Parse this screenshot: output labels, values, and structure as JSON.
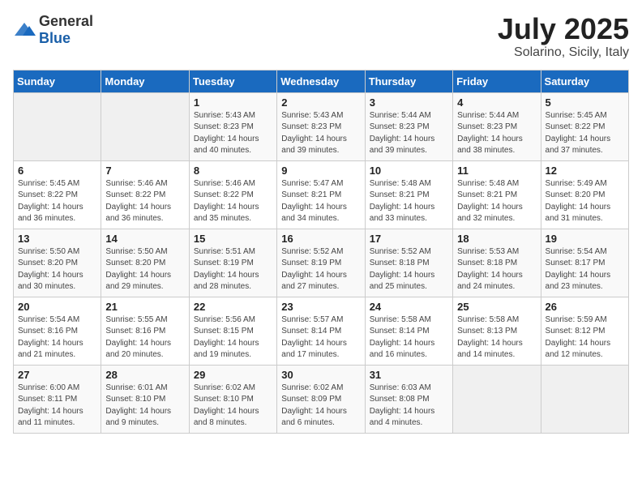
{
  "logo": {
    "general": "General",
    "blue": "Blue"
  },
  "header": {
    "month": "July 2025",
    "location": "Solarino, Sicily, Italy"
  },
  "days_of_week": [
    "Sunday",
    "Monday",
    "Tuesday",
    "Wednesday",
    "Thursday",
    "Friday",
    "Saturday"
  ],
  "weeks": [
    [
      {
        "day": "",
        "sunrise": "",
        "sunset": "",
        "daylight": ""
      },
      {
        "day": "",
        "sunrise": "",
        "sunset": "",
        "daylight": ""
      },
      {
        "day": "1",
        "sunrise": "Sunrise: 5:43 AM",
        "sunset": "Sunset: 8:23 PM",
        "daylight": "Daylight: 14 hours and 40 minutes."
      },
      {
        "day": "2",
        "sunrise": "Sunrise: 5:43 AM",
        "sunset": "Sunset: 8:23 PM",
        "daylight": "Daylight: 14 hours and 39 minutes."
      },
      {
        "day": "3",
        "sunrise": "Sunrise: 5:44 AM",
        "sunset": "Sunset: 8:23 PM",
        "daylight": "Daylight: 14 hours and 39 minutes."
      },
      {
        "day": "4",
        "sunrise": "Sunrise: 5:44 AM",
        "sunset": "Sunset: 8:23 PM",
        "daylight": "Daylight: 14 hours and 38 minutes."
      },
      {
        "day": "5",
        "sunrise": "Sunrise: 5:45 AM",
        "sunset": "Sunset: 8:22 PM",
        "daylight": "Daylight: 14 hours and 37 minutes."
      }
    ],
    [
      {
        "day": "6",
        "sunrise": "Sunrise: 5:45 AM",
        "sunset": "Sunset: 8:22 PM",
        "daylight": "Daylight: 14 hours and 36 minutes."
      },
      {
        "day": "7",
        "sunrise": "Sunrise: 5:46 AM",
        "sunset": "Sunset: 8:22 PM",
        "daylight": "Daylight: 14 hours and 36 minutes."
      },
      {
        "day": "8",
        "sunrise": "Sunrise: 5:46 AM",
        "sunset": "Sunset: 8:22 PM",
        "daylight": "Daylight: 14 hours and 35 minutes."
      },
      {
        "day": "9",
        "sunrise": "Sunrise: 5:47 AM",
        "sunset": "Sunset: 8:21 PM",
        "daylight": "Daylight: 14 hours and 34 minutes."
      },
      {
        "day": "10",
        "sunrise": "Sunrise: 5:48 AM",
        "sunset": "Sunset: 8:21 PM",
        "daylight": "Daylight: 14 hours and 33 minutes."
      },
      {
        "day": "11",
        "sunrise": "Sunrise: 5:48 AM",
        "sunset": "Sunset: 8:21 PM",
        "daylight": "Daylight: 14 hours and 32 minutes."
      },
      {
        "day": "12",
        "sunrise": "Sunrise: 5:49 AM",
        "sunset": "Sunset: 8:20 PM",
        "daylight": "Daylight: 14 hours and 31 minutes."
      }
    ],
    [
      {
        "day": "13",
        "sunrise": "Sunrise: 5:50 AM",
        "sunset": "Sunset: 8:20 PM",
        "daylight": "Daylight: 14 hours and 30 minutes."
      },
      {
        "day": "14",
        "sunrise": "Sunrise: 5:50 AM",
        "sunset": "Sunset: 8:20 PM",
        "daylight": "Daylight: 14 hours and 29 minutes."
      },
      {
        "day": "15",
        "sunrise": "Sunrise: 5:51 AM",
        "sunset": "Sunset: 8:19 PM",
        "daylight": "Daylight: 14 hours and 28 minutes."
      },
      {
        "day": "16",
        "sunrise": "Sunrise: 5:52 AM",
        "sunset": "Sunset: 8:19 PM",
        "daylight": "Daylight: 14 hours and 27 minutes."
      },
      {
        "day": "17",
        "sunrise": "Sunrise: 5:52 AM",
        "sunset": "Sunset: 8:18 PM",
        "daylight": "Daylight: 14 hours and 25 minutes."
      },
      {
        "day": "18",
        "sunrise": "Sunrise: 5:53 AM",
        "sunset": "Sunset: 8:18 PM",
        "daylight": "Daylight: 14 hours and 24 minutes."
      },
      {
        "day": "19",
        "sunrise": "Sunrise: 5:54 AM",
        "sunset": "Sunset: 8:17 PM",
        "daylight": "Daylight: 14 hours and 23 minutes."
      }
    ],
    [
      {
        "day": "20",
        "sunrise": "Sunrise: 5:54 AM",
        "sunset": "Sunset: 8:16 PM",
        "daylight": "Daylight: 14 hours and 21 minutes."
      },
      {
        "day": "21",
        "sunrise": "Sunrise: 5:55 AM",
        "sunset": "Sunset: 8:16 PM",
        "daylight": "Daylight: 14 hours and 20 minutes."
      },
      {
        "day": "22",
        "sunrise": "Sunrise: 5:56 AM",
        "sunset": "Sunset: 8:15 PM",
        "daylight": "Daylight: 14 hours and 19 minutes."
      },
      {
        "day": "23",
        "sunrise": "Sunrise: 5:57 AM",
        "sunset": "Sunset: 8:14 PM",
        "daylight": "Daylight: 14 hours and 17 minutes."
      },
      {
        "day": "24",
        "sunrise": "Sunrise: 5:58 AM",
        "sunset": "Sunset: 8:14 PM",
        "daylight": "Daylight: 14 hours and 16 minutes."
      },
      {
        "day": "25",
        "sunrise": "Sunrise: 5:58 AM",
        "sunset": "Sunset: 8:13 PM",
        "daylight": "Daylight: 14 hours and 14 minutes."
      },
      {
        "day": "26",
        "sunrise": "Sunrise: 5:59 AM",
        "sunset": "Sunset: 8:12 PM",
        "daylight": "Daylight: 14 hours and 12 minutes."
      }
    ],
    [
      {
        "day": "27",
        "sunrise": "Sunrise: 6:00 AM",
        "sunset": "Sunset: 8:11 PM",
        "daylight": "Daylight: 14 hours and 11 minutes."
      },
      {
        "day": "28",
        "sunrise": "Sunrise: 6:01 AM",
        "sunset": "Sunset: 8:10 PM",
        "daylight": "Daylight: 14 hours and 9 minutes."
      },
      {
        "day": "29",
        "sunrise": "Sunrise: 6:02 AM",
        "sunset": "Sunset: 8:10 PM",
        "daylight": "Daylight: 14 hours and 8 minutes."
      },
      {
        "day": "30",
        "sunrise": "Sunrise: 6:02 AM",
        "sunset": "Sunset: 8:09 PM",
        "daylight": "Daylight: 14 hours and 6 minutes."
      },
      {
        "day": "31",
        "sunrise": "Sunrise: 6:03 AM",
        "sunset": "Sunset: 8:08 PM",
        "daylight": "Daylight: 14 hours and 4 minutes."
      },
      {
        "day": "",
        "sunrise": "",
        "sunset": "",
        "daylight": ""
      },
      {
        "day": "",
        "sunrise": "",
        "sunset": "",
        "daylight": ""
      }
    ]
  ]
}
